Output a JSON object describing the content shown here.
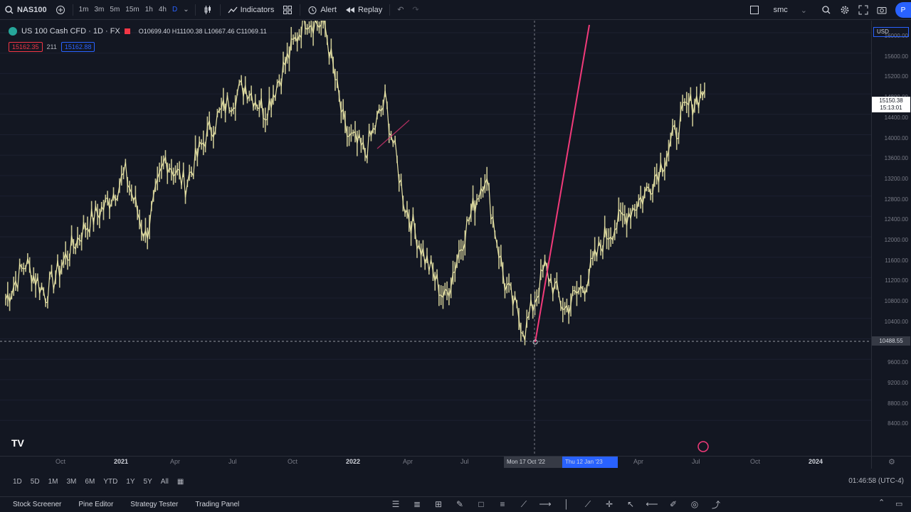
{
  "toolbar": {
    "symbol": "NAS100",
    "intervals": [
      "1m",
      "3m",
      "5m",
      "15m",
      "1h",
      "4h",
      "D"
    ],
    "indicators_label": "Indicators",
    "alert_label": "Alert",
    "replay_label": "Replay",
    "layout_name": "smc",
    "avatar_letter": "P"
  },
  "legend": {
    "title": "US 100 Cash CFD · 1D · FX",
    "ohlc": "O10699.40 H11100.38 L10667.46 C11069.11",
    "pill_sell": "15162.35",
    "spread": "211",
    "pill_buy": "15162.88"
  },
  "price_scale": {
    "currency": "USD",
    "labels": [
      "16000.00",
      "15600.00",
      "15200.00",
      "14800.00",
      "14400.00",
      "14000.00",
      "13600.00",
      "13200.00",
      "12800.00",
      "12400.00",
      "12000.00",
      "11600.00",
      "11200.00",
      "10800.00",
      "10400.00",
      "10000.00",
      "9600.00",
      "9200.00",
      "8800.00",
      "8400.00"
    ],
    "current_price": "15150.38",
    "current_time": "15:13:01",
    "crosshair_price": "10488.55"
  },
  "time_scale": {
    "labels": [
      "Oct",
      "2021",
      "Apr",
      "Jul",
      "Oct",
      "2022",
      "Apr",
      "Jul",
      "Apr",
      "Jul",
      "Oct",
      "2024"
    ],
    "bold_labels": [
      "2021",
      "2022",
      "2024"
    ],
    "crosshair_date": "Mon 17 Oct '22",
    "range_end_date": "Thu 12 Jan '23"
  },
  "range_bar": {
    "ranges": [
      "1D",
      "5D",
      "1M",
      "3M",
      "6M",
      "YTD",
      "1Y",
      "5Y",
      "All"
    ],
    "clock": "01:46:58 (UTC-4)"
  },
  "bottom_tabs": [
    "Stock Screener",
    "Pine Editor",
    "Strategy Tester",
    "Trading Panel"
  ],
  "logo_text": "TV",
  "colors": {
    "background": "#131722",
    "candle": "#e8e4a6",
    "accent_line": "#f23a7a",
    "blue": "#2962ff"
  },
  "chart_data": {
    "type": "line",
    "title": "US 100 Cash CFD · 1D · FX",
    "series": [
      {
        "name": "US 100 Cash CFD",
        "x": [
          "2020-08",
          "2020-09",
          "2020-10",
          "2020-11",
          "2020-12",
          "2021-01",
          "2021-02",
          "2021-03",
          "2021-04",
          "2021-05",
          "2021-06",
          "2021-07",
          "2021-08",
          "2021-09",
          "2021-10",
          "2021-11",
          "2021-12",
          "2022-01",
          "2022-02",
          "2022-03",
          "2022-04",
          "2022-05",
          "2022-06",
          "2022-07",
          "2022-08",
          "2022-09",
          "2022-10",
          "2022-11",
          "2022-12",
          "2023-01",
          "2023-02",
          "2023-03",
          "2023-04",
          "2023-05",
          "2023-06",
          "2023-07"
        ],
        "values": [
          11200,
          11900,
          11300,
          12000,
          12600,
          13000,
          13600,
          12400,
          13900,
          13400,
          14300,
          14900,
          15300,
          14800,
          15700,
          16600,
          16400,
          14400,
          14000,
          15000,
          13000,
          12000,
          11200,
          12500,
          13600,
          11500,
          10600,
          11800,
          11000,
          11500,
          12400,
          12800,
          13200,
          13900,
          14800,
          15200
        ]
      }
    ],
    "ylim": [
      8400,
      16300
    ]
  }
}
